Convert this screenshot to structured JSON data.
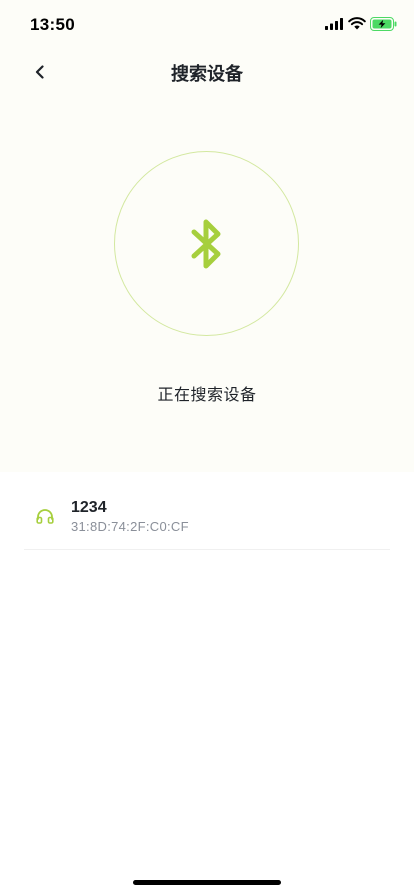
{
  "status_bar": {
    "time": "13:50",
    "icons": [
      "signal-icon",
      "wifi-icon",
      "battery-charging-icon"
    ]
  },
  "nav": {
    "title": "搜索设备",
    "back_icon": "chevron-left-icon"
  },
  "scan": {
    "icon": "bluetooth-icon",
    "status_text": "正在搜索设备"
  },
  "devices": [
    {
      "icon": "headphones-icon",
      "name": "1234",
      "mac": "31:8D:74:2F:C0:CF"
    }
  ],
  "colors": {
    "accent": "#a6cf3d",
    "circle_border": "#d3e8a0",
    "top_background": "#fdfdf8",
    "text_primary": "#1f2329",
    "text_secondary": "#8a8f99",
    "battery_green": "#4cd964"
  }
}
